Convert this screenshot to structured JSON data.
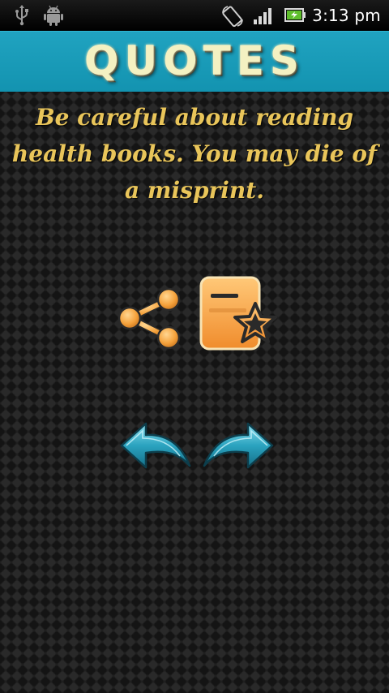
{
  "status_bar": {
    "time": "3:13 pm",
    "icons": [
      "usb-icon",
      "android-icon",
      "rotate-icon",
      "signal-icon",
      "battery-icon"
    ]
  },
  "header": {
    "title": "QUOTES",
    "background_color": "#1a9cb9",
    "title_color": "#f4f1c2"
  },
  "quote": {
    "text": "Be careful about reading health books. You may die of a misprint.",
    "color": "#e9c55a"
  },
  "actions": {
    "share_icon": "share-icon",
    "favorite_icon": "favorite-book-star-icon",
    "back_icon": "back-arrow-icon",
    "next_icon": "forward-arrow-icon",
    "accent_orange": "#f5a23c",
    "accent_teal": "#2aa3bf"
  }
}
